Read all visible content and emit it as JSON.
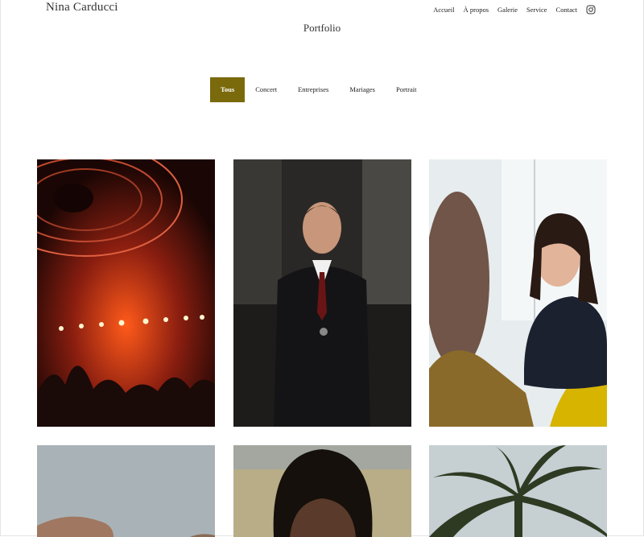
{
  "site": {
    "brand": "Nina Carducci"
  },
  "nav": {
    "items": [
      {
        "label": "Accueil"
      },
      {
        "label": "À propos"
      },
      {
        "label": "Galerie"
      },
      {
        "label": "Service"
      },
      {
        "label": "Contact"
      }
    ],
    "social_icon": "instagram-icon"
  },
  "page": {
    "title": "Portfolio"
  },
  "filters": {
    "items": [
      {
        "label": "Tous",
        "active": true
      },
      {
        "label": "Concert",
        "active": false
      },
      {
        "label": "Entreprises",
        "active": false
      },
      {
        "label": "Mariages",
        "active": false
      },
      {
        "label": "Portrait",
        "active": false
      }
    ],
    "active_color": "#7a6a0c"
  },
  "gallery": {
    "images": [
      {
        "subject": "concert stage with red lights"
      },
      {
        "subject": "businessman in suit with arms crossed"
      },
      {
        "subject": "smiling woman in meeting"
      },
      {
        "subject": "hand against grey sky"
      },
      {
        "subject": "portrait of young man"
      },
      {
        "subject": "palm tree"
      }
    ]
  }
}
